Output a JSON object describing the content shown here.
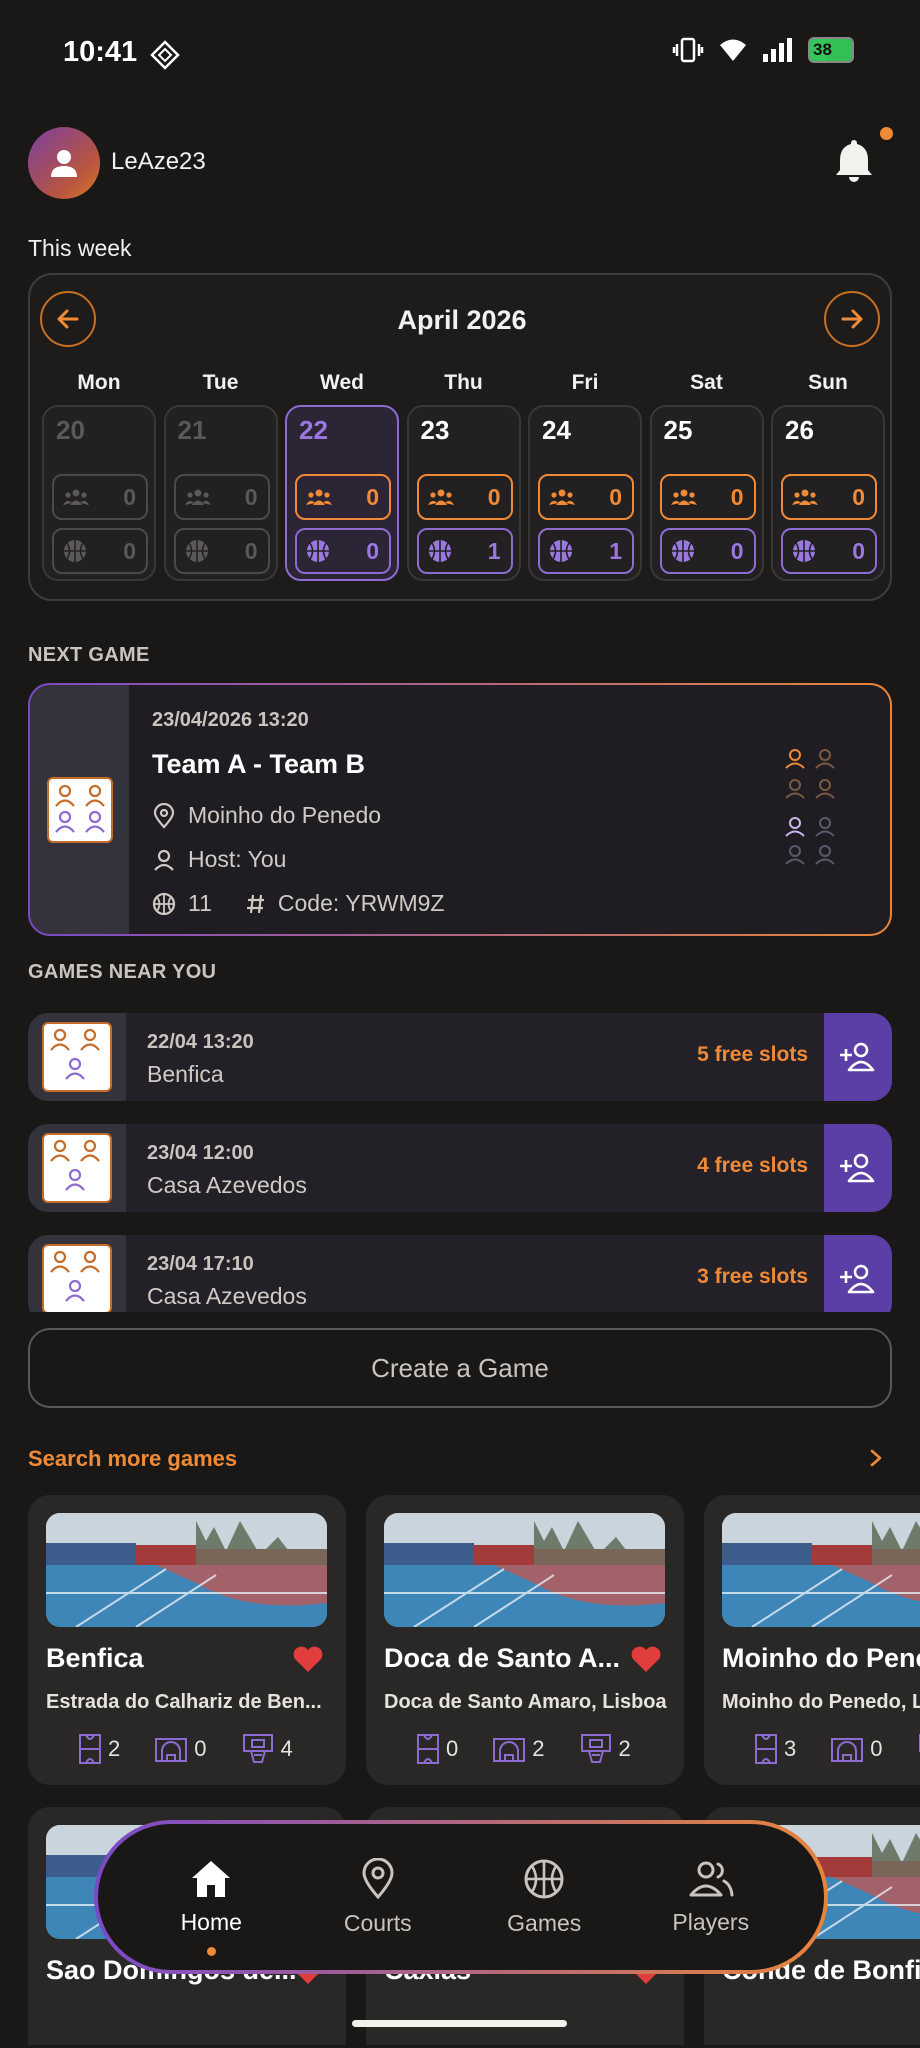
{
  "status": {
    "time": "10:41",
    "battery": "38"
  },
  "header": {
    "username": "LeAze23"
  },
  "week": {
    "label": "This week",
    "month": "April 2026",
    "days": [
      {
        "name": "Mon",
        "num": "20",
        "players": "0",
        "games": "0",
        "state": "past"
      },
      {
        "name": "Tue",
        "num": "21",
        "players": "0",
        "games": "0",
        "state": "past"
      },
      {
        "name": "Wed",
        "num": "22",
        "players": "0",
        "games": "0",
        "state": "today"
      },
      {
        "name": "Thu",
        "num": "23",
        "players": "0",
        "games": "1",
        "state": "future"
      },
      {
        "name": "Fri",
        "num": "24",
        "players": "0",
        "games": "1",
        "state": "future"
      },
      {
        "name": "Sat",
        "num": "25",
        "players": "0",
        "games": "0",
        "state": "future"
      },
      {
        "name": "Sun",
        "num": "26",
        "players": "0",
        "games": "0",
        "state": "future"
      }
    ]
  },
  "next_game": {
    "label": "NEXT GAME",
    "datetime": "23/04/2026 13:20",
    "title": "Team A - Team B",
    "location": "Moinho do Penedo",
    "host": "Host: You",
    "court_number": "11",
    "code": "Code: YRWM9Z"
  },
  "near": {
    "label": "GAMES NEAR YOU",
    "games": [
      {
        "date": "22/04 13:20",
        "place": "Benfica",
        "slots": "5 free slots"
      },
      {
        "date": "23/04 12:00",
        "place": "Casa Azevedos",
        "slots": "4 free slots"
      },
      {
        "date": "23/04 17:10",
        "place": "Casa Azevedos",
        "slots": "3 free slots"
      }
    ]
  },
  "create_game": "Create a Game",
  "search_more": "Search more games",
  "courts": [
    {
      "name": "Benfica",
      "address": "Estrada do Calhariz de Ben...",
      "s1": "2",
      "s2": "0",
      "s3": "4"
    },
    {
      "name": "Doca de Santo A...",
      "address": "Doca de Santo Amaro, Lisboa",
      "s1": "0",
      "s2": "2",
      "s3": "2"
    },
    {
      "name": "Moinho do Pene",
      "address": "Moinho do Penedo, L",
      "s1": "3",
      "s2": "0",
      "s3": ""
    }
  ],
  "courts_row2": [
    {
      "name": "Sao Domingos de..."
    },
    {
      "name": "Caxias"
    },
    {
      "name": "Conde de Bonfin"
    }
  ],
  "nav": {
    "home": "Home",
    "courts": "Courts",
    "games": "Games",
    "players": "Players"
  },
  "colors": {
    "accent_orange": "#f08a36",
    "accent_purple": "#8d6bd0",
    "background": "#1a1817"
  }
}
